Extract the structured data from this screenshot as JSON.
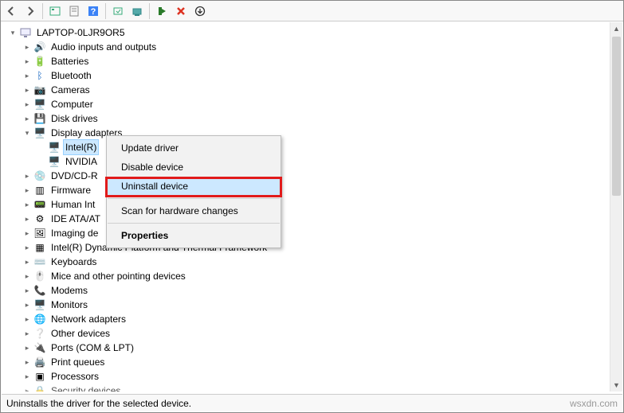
{
  "toolbar": {
    "back": "←",
    "forward": "→"
  },
  "root": {
    "label": "LAPTOP-0LJR9OR5"
  },
  "categories": [
    {
      "label": "Audio inputs and outputs",
      "expanded": false
    },
    {
      "label": "Batteries",
      "expanded": false
    },
    {
      "label": "Bluetooth",
      "expanded": false
    },
    {
      "label": "Cameras",
      "expanded": false
    },
    {
      "label": "Computer",
      "expanded": false
    },
    {
      "label": "Disk drives",
      "expanded": false
    },
    {
      "label": "Display adapters",
      "expanded": true,
      "children": [
        {
          "label": "Intel(R)",
          "selected": true
        },
        {
          "label": "NVIDIA"
        }
      ]
    },
    {
      "label": "DVD/CD-R",
      "expanded": false
    },
    {
      "label": "Firmware",
      "expanded": false
    },
    {
      "label": "Human Int",
      "expanded": false
    },
    {
      "label": "IDE ATA/AT",
      "expanded": false
    },
    {
      "label": "Imaging de",
      "expanded": false
    },
    {
      "label": "Intel(R) Dynamic Platform and Thermal Framework",
      "expanded": false
    },
    {
      "label": "Keyboards",
      "expanded": false
    },
    {
      "label": "Mice and other pointing devices",
      "expanded": false
    },
    {
      "label": "Modems",
      "expanded": false
    },
    {
      "label": "Monitors",
      "expanded": false
    },
    {
      "label": "Network adapters",
      "expanded": false
    },
    {
      "label": "Other devices",
      "expanded": false
    },
    {
      "label": "Ports (COM & LPT)",
      "expanded": false
    },
    {
      "label": "Print queues",
      "expanded": false
    },
    {
      "label": "Processors",
      "expanded": false
    },
    {
      "label": "Security devices",
      "expanded": false
    }
  ],
  "context_menu": {
    "update": "Update driver",
    "disable": "Disable device",
    "uninstall": "Uninstall device",
    "scan": "Scan for hardware changes",
    "properties": "Properties"
  },
  "statusbar": {
    "text": "Uninstalls the driver for the selected device."
  },
  "watermark": "wsxdn.com"
}
